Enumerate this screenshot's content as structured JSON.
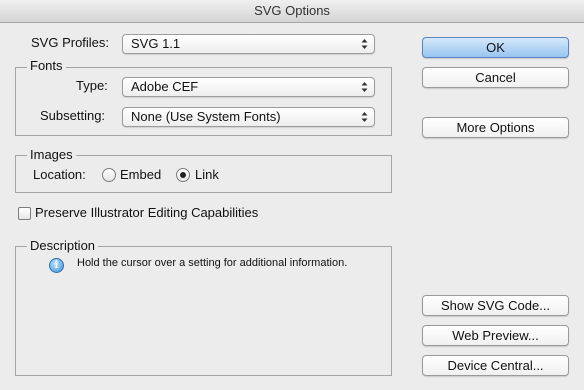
{
  "window": {
    "title": "SVG Options"
  },
  "profiles": {
    "label": "SVG Profiles:",
    "value": "SVG 1.1"
  },
  "fonts": {
    "group_label": "Fonts",
    "type_label": "Type:",
    "type_value": "Adobe CEF",
    "subsetting_label": "Subsetting:",
    "subsetting_value": "None (Use System Fonts)"
  },
  "images": {
    "group_label": "Images",
    "location_label": "Location:",
    "embed_label": "Embed",
    "link_label": "Link",
    "selected": "Link"
  },
  "preserve": {
    "label": "Preserve Illustrator Editing Capabilities",
    "checked": false
  },
  "description": {
    "group_label": "Description",
    "text": "Hold the cursor over a setting for additional information.",
    "icon": "info-icon"
  },
  "buttons": {
    "ok": "OK",
    "cancel": "Cancel",
    "more_options": "More Options",
    "show_svg_code": "Show SVG Code...",
    "web_preview": "Web Preview...",
    "device_central": "Device Central..."
  }
}
